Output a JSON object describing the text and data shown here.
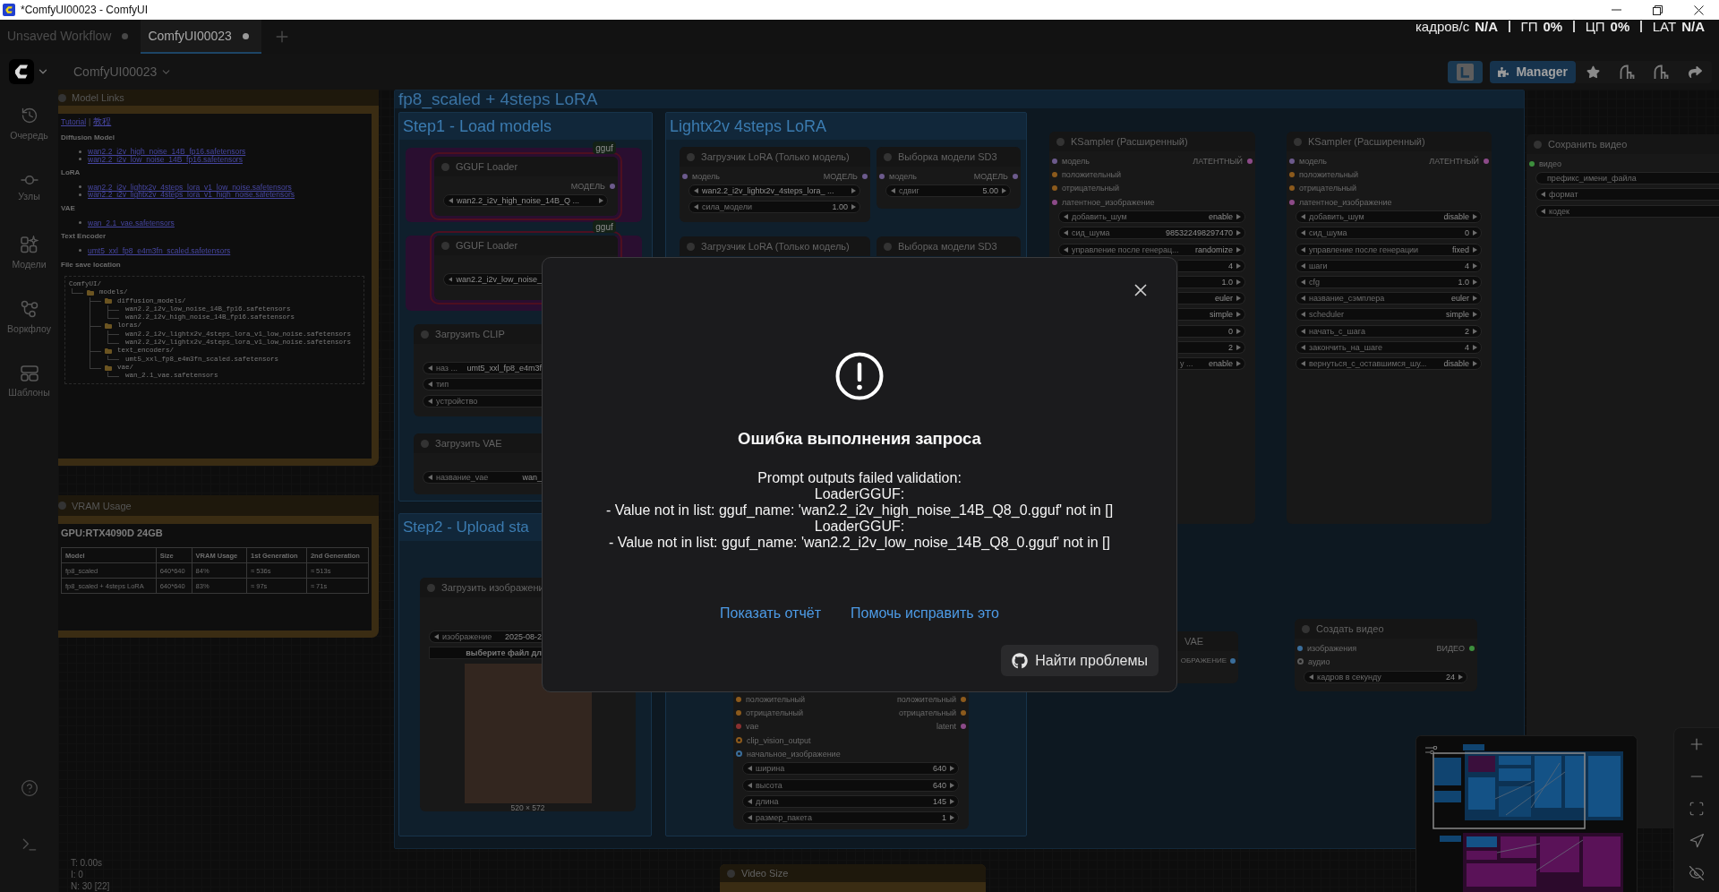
{
  "window": {
    "title": "*ComfyUI00023 - ComfyUI"
  },
  "tabs": [
    {
      "label": "Unsaved Workflow",
      "selected": false,
      "unsaved": true
    },
    {
      "label": "ComfyUI00023",
      "selected": true,
      "unsaved": true
    }
  ],
  "performance_overlay": [
    {
      "label": "кадров/с",
      "value": "N/A"
    },
    {
      "label": "ГП",
      "value": "0%"
    },
    {
      "label": "ЦП",
      "value": "0%"
    },
    {
      "label": "LAT",
      "value": "N/A"
    }
  ],
  "menu": {
    "workflow_name": "ComfyUI00023",
    "manager_label": "Manager"
  },
  "sidebar": {
    "items": [
      {
        "label": "Очередь"
      },
      {
        "label": "Узлы"
      },
      {
        "label": "Модели"
      },
      {
        "label": "Воркфлоу"
      },
      {
        "label": "Шаблоны"
      }
    ]
  },
  "canvas": {
    "groups": [
      {
        "title": "fp8_scaled + 4steps LoRA"
      },
      {
        "title": "Step1 - Load models"
      },
      {
        "title": "Lightx2v 4steps LoRA"
      },
      {
        "title": "Step2 - Upload sta"
      }
    ],
    "nodes": [
      {
        "kind": "markdown",
        "title": "Model Links",
        "color": "#3a2c13",
        "content": {
          "links": [
            "Tutorial",
            "教程"
          ],
          "separator": "|",
          "sections": [
            {
              "heading": "Diffusion Model",
              "items": [
                "wan2.2_i2v_high_noise_14B_fp16.safetensors",
                "wan2.2_i2v_low_noise_14B_fp16.safetensors"
              ]
            },
            {
              "heading": "LoRA",
              "items": [
                "wan2.2_i2v_lightx2v_4steps_lora_v1_low_noise.safetensors",
                "wan2.2_i2v_lightx2v_4steps_lora_v1_high_noise.safetensors"
              ]
            },
            {
              "heading": "VAE",
              "items": [
                "wan_2.1_vae.safetensors"
              ]
            },
            {
              "heading": "Text Encoder",
              "items": [
                "umt5_xxl_fp8_e4m3fn_scaled.safetensors"
              ]
            }
          ],
          "tree_heading": "File save location",
          "file_tree": {
            "label": "ComfyUI/",
            "folder": false,
            "children": [
              {
                "label": "models/",
                "folder": true,
                "children": [
                  {
                    "label": "diffusion_models/",
                    "folder": true,
                    "children": [
                      {
                        "label": "wan2.2_i2v_low_noise_14B_fp16.safetensors",
                        "folder": false
                      },
                      {
                        "label": "wan2.2_i2v_high_noise_14B_fp16.safetensors",
                        "folder": false
                      }
                    ]
                  },
                  {
                    "label": "loras/",
                    "folder": true,
                    "children": [
                      {
                        "label": "wan2.2_i2v_lightx2v_4steps_lora_v1_low_noise.safetensors",
                        "folder": false
                      },
                      {
                        "label": "wan2.2_i2v_lightx2v_4steps_lora_v1_low_noise.safetensors",
                        "folder": false
                      }
                    ]
                  },
                  {
                    "label": "text_encoders/",
                    "folder": true,
                    "children": [
                      {
                        "label": "umt5_xxl_fp8_e4m3fn_scaled.safetensors",
                        "folder": false
                      }
                    ]
                  },
                  {
                    "label": "vae/",
                    "folder": true,
                    "children": [
                      {
                        "label": "wan_2.1_vae.safetensors",
                        "folder": false
                      }
                    ]
                  }
                ]
              }
            ]
          }
        }
      },
      {
        "kind": "table",
        "title": "VRAM Usage",
        "color": "#3a2c13",
        "heading": "GPU:RTX4090D 24GB",
        "table": {
          "columns": [
            "Model",
            "Size",
            "VRAM Usage",
            "1st Generation",
            "2nd Generation"
          ],
          "rows": [
            [
              "fp8_scaled",
              "640*640",
              "84%",
              "≈ 536s",
              "≈ 513s"
            ],
            [
              "fp8_scaled + 4steps LoRA",
              "640*640",
              "83%",
              "≈ 97s",
              "≈ 71s"
            ]
          ]
        }
      },
      {
        "kind": "bypassed"
      },
      {
        "kind": "standard",
        "title": "GGUF Loader",
        "error": true,
        "badge": "gguf",
        "slots": [
          {
            "output": {
              "label": "МОДЕЛЬ",
              "color": "#6c5a8c"
            }
          }
        ],
        "widgets": [
          {
            "kind": "stepper",
            "value": "wan2.2_i2v_high_noise_14B_Q ..."
          }
        ]
      },
      {
        "kind": "standard",
        "title": "GGUF Loader",
        "error": true,
        "badge": "gguf",
        "widgets": [
          {
            "kind": "stepper",
            "value": "wan2.2_i2v_low_noise_"
          }
        ]
      },
      {
        "kind": "bypassed"
      },
      {
        "kind": "standard",
        "title": "Загрузить CLIP",
        "error": false,
        "widgets": [
          {
            "kind": "stepper",
            "label": "наз ...",
            "value": "umt5_xxl_fp8_e4m3f"
          },
          {
            "kind": "stepper",
            "label": "тип"
          },
          {
            "kind": "stepper",
            "label": "устройство"
          }
        ]
      },
      {
        "kind": "standard",
        "title": "Загрузить VAE",
        "error": false,
        "widgets": [
          {
            "kind": "stepper",
            "label": "название_vae",
            "value": "wan_"
          }
        ]
      },
      {
        "kind": "image_loader",
        "title": "Загрузить изображени",
        "widgets": [
          {
            "kind": "stepper",
            "label": "изображение",
            "value": "2025-08-2"
          }
        ],
        "upload_button": "выберите файл дл",
        "image_caption": "520 × 572"
      },
      {
        "kind": "standard",
        "title": "Загрузчик LoRA (Только модель)",
        "error": false,
        "slots": [
          {
            "input": {
              "label": "модель",
              "color": "#6c5a8c",
              "optional": false
            },
            "output": {
              "label": "МОДЕЛЬ",
              "color": "#6c5a8c"
            }
          }
        ],
        "widgets": [
          {
            "kind": "stepper",
            "value": "wan2.2_i2v_lightx2v_4steps_lora_ ..."
          },
          {
            "kind": "stepper",
            "label": "сила_модели",
            "value": "1.00"
          }
        ]
      },
      {
        "kind": "standard",
        "title": "Выборка модели SD3",
        "error": false,
        "slots": [
          {
            "input": {
              "label": "модель",
              "color": "#6c5a8c",
              "optional": false
            },
            "output": {
              "label": "МОДЕЛЬ",
              "color": "#6c5a8c"
            }
          }
        ],
        "widgets": [
          {
            "kind": "stepper",
            "label": "сдвиг",
            "value": "5.00"
          }
        ]
      },
      {
        "kind": "standard",
        "title": "Загрузчик LoRA (Только модель)",
        "error": false
      },
      {
        "kind": "standard",
        "title": "Выборка модели SD3",
        "error": false
      },
      {
        "kind": "standard",
        "error": false,
        "slots": [
          {
            "input": {
              "label": "положительный",
              "color": "#8c5a1c",
              "optional": false
            },
            "output": {
              "label": "положительный",
              "color": "#8c5a1c"
            }
          },
          {
            "input": {
              "label": "отрицательный",
              "color": "#8c5a1c",
              "optional": false
            },
            "output": {
              "label": "отрицательный",
              "color": "#8c5a1c"
            }
          },
          {
            "input": {
              "label": "vae",
              "color": "#8a3030",
              "optional": false
            },
            "output": {
              "label": "latent",
              "color": "#8c4a88"
            }
          },
          {
            "input": {
              "label": "clip_vision_output",
              "color": "#8c5a1c",
              "optional": true
            }
          },
          {
            "input": {
              "label": "начальное_изображение",
              "color": "#3a6d9a",
              "optional": true
            }
          }
        ],
        "widgets": [
          {
            "kind": "stepper",
            "label": "ширина",
            "value": "640"
          },
          {
            "kind": "stepper",
            "label": "высота",
            "value": "640"
          },
          {
            "kind": "stepper",
            "label": "длина",
            "value": "145"
          },
          {
            "kind": "stepper",
            "label": "размер_пакета",
            "value": "1"
          }
        ]
      },
      {
        "kind": "standard",
        "title": "Video Size",
        "error": false,
        "color": "#3a2c13"
      },
      {
        "kind": "standard",
        "title": "KSampler (Расширенный)",
        "error": false,
        "slots": [
          {
            "input": {
              "label": "модель",
              "color": "#6c5a8c",
              "optional": false
            },
            "output": {
              "label": "ЛАТЕНТНЫЙ",
              "color": "#8c4a88"
            }
          },
          {
            "input": {
              "label": "положительный",
              "color": "#8c5a1c",
              "optional": false
            }
          },
          {
            "input": {
              "label": "отрицательный",
              "color": "#8c5a1c",
              "optional": false
            }
          },
          {
            "input": {
              "label": "латентное_изображение",
              "color": "#8c4a88",
              "optional": false
            }
          }
        ],
        "widgets": [
          {
            "kind": "stepper",
            "label": "добавить_шум",
            "value": "enable"
          },
          {
            "kind": "stepper",
            "label": "сид_шума",
            "value": "985322498297470"
          },
          {
            "kind": "stepper",
            "label": "управление после генерац...",
            "value": "randomize"
          },
          {
            "kind": "stepper",
            "value": "4"
          },
          {
            "kind": "stepper",
            "value": "1.0"
          },
          {
            "kind": "stepper",
            "value": "euler"
          },
          {
            "kind": "stepper",
            "value": "simple"
          },
          {
            "kind": "stepper",
            "value": "0"
          },
          {
            "kind": "stepper",
            "value": "2"
          },
          {
            "kind": "stepper",
            "label": "у ...",
            "value": "enable"
          }
        ]
      },
      {
        "kind": "standard",
        "title": "VAE",
        "error": false,
        "slots": [
          {
            "output": {
              "label": "ОБРАЖЕНИЕ",
              "color": "#3a6d9a"
            }
          }
        ]
      },
      {
        "kind": "standard",
        "title": "KSampler (Расширенный)",
        "error": false,
        "slots": [
          {
            "input": {
              "label": "модель",
              "color": "#6c5a8c",
              "optional": false
            },
            "output": {
              "label": "ЛАТЕНТНЫЙ",
              "color": "#8c4a88"
            }
          },
          {
            "input": {
              "label": "положительный",
              "color": "#8c5a1c",
              "optional": false
            }
          },
          {
            "input": {
              "label": "отрицательный",
              "color": "#8c5a1c",
              "optional": false
            }
          },
          {
            "input": {
              "label": "латентное_изображение",
              "color": "#8c4a88",
              "optional": false
            }
          }
        ],
        "widgets": [
          {
            "kind": "stepper",
            "label": "добавить_шум",
            "value": "disable"
          },
          {
            "kind": "stepper",
            "label": "сид_шума",
            "value": "0"
          },
          {
            "kind": "stepper",
            "label": "управление после генерации",
            "value": "fixed"
          },
          {
            "kind": "stepper",
            "label": "шаги",
            "value": "4"
          },
          {
            "kind": "stepper",
            "label": "cfg",
            "value": "1.0"
          },
          {
            "kind": "stepper",
            "label": "название_сэмплера",
            "value": "euler"
          },
          {
            "kind": "stepper",
            "label": "scheduler",
            "value": "simple"
          },
          {
            "kind": "stepper",
            "label": "начать_с_шага",
            "value": "2"
          },
          {
            "kind": "stepper",
            "label": "закончить_на_шаге",
            "value": "4"
          },
          {
            "kind": "stepper",
            "label": "вернуться_с_оставшимся_шу...",
            "value": "disable"
          }
        ]
      },
      {
        "kind": "standard",
        "title": "Создать видео",
        "error": false,
        "slots": [
          {
            "input": {
              "label": "изображения",
              "color": "#3a6d9a",
              "optional": false
            },
            "output": {
              "label": "ВИДЕО",
              "color": "#3d8f3d"
            }
          },
          {
            "input": {
              "label": "аудио",
              "color": "#5a5a5a",
              "optional": true
            }
          }
        ],
        "widgets": [
          {
            "kind": "stepper",
            "label": "кадров в секунду",
            "value": "24"
          }
        ]
      },
      {
        "kind": "standard",
        "title": "Сохранить видео",
        "error": false,
        "slots": [
          {
            "input": {
              "label": "видео",
              "color": "#3d8f3d",
              "optional": false
            }
          }
        ],
        "widgets": [
          {
            "kind": "text",
            "label": "префикс_имени_файла"
          },
          {
            "kind": "stepper",
            "label": "формат"
          },
          {
            "kind": "stepper",
            "label": "кодек"
          }
        ]
      }
    ],
    "stats": [
      "T: 0.00s",
      "I: 0",
      "N: 30 [22]"
    ]
  },
  "dialog": {
    "title": "Ошибка выполнения запроса",
    "message": "Prompt outputs failed validation:\nLoaderGGUF:\n- Value not in list: gguf_name: 'wan2.2_i2v_high_noise_14B_Q8_0.gguf' not in []\nLoaderGGUF:\n- Value not in list: gguf_name: 'wan2.2_i2v_low_noise_14B_Q8_0.gguf' not in []",
    "links": [
      "Показать отчёт",
      "Помочь исправить это"
    ],
    "button": "Найти проблемы"
  }
}
